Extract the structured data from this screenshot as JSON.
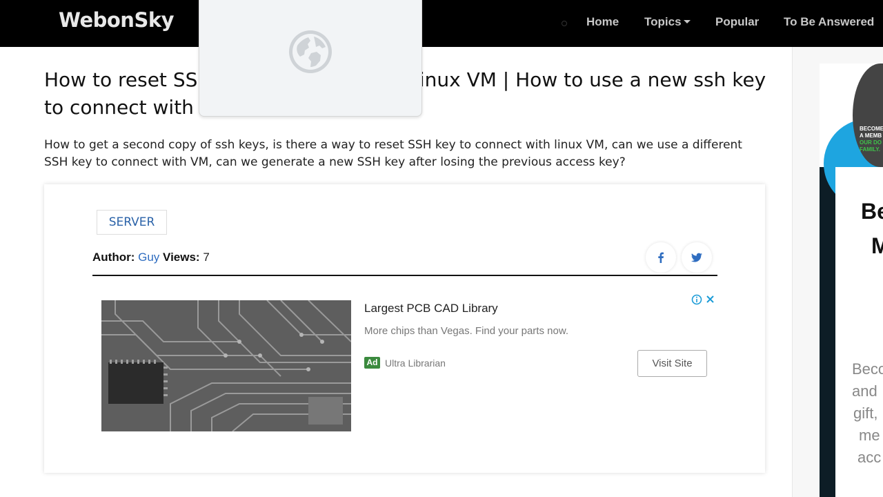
{
  "header": {
    "brand": "WebonSky",
    "nav": [
      {
        "label": "Home"
      },
      {
        "label": "Topics"
      },
      {
        "label": "Popular"
      },
      {
        "label": "To Be Answered"
      }
    ]
  },
  "article": {
    "title": "How to reset SSH key to connect with linux VM | How to use a new ssh key to connect with VM",
    "intro": "How to get a second copy of ssh keys, is there a way to reset SSH key to connect with linux VM, can we use a different SSH key to connect with VM, can we generate a new SSH key after losing the previous access key?",
    "tag": "SERVER",
    "author_label": "Author:",
    "author": "Guy",
    "views_label": "Views:",
    "views": "7"
  },
  "ad": {
    "title": "Largest PCB CAD Library",
    "description": "More chips than Vegas. Find your parts now.",
    "badge": "Ad",
    "source": "Ultra Librarian",
    "cta": "Visit Site"
  },
  "sidebar_ad": {
    "small_lines": [
      "BECOME",
      "A MEMB",
      "OUR DO",
      "FAMILY."
    ],
    "heading_lines": [
      "Be",
      "M"
    ],
    "text_lines": [
      "Beco",
      "and",
      "gift,",
      "me",
      "acc"
    ]
  },
  "colors": {
    "navbar": "#000000",
    "link": "#2f6dc0",
    "ad_badge": "#3b8a3e",
    "side_accent": "#1ea5e0"
  },
  "icons": {
    "popup": "globe-icon",
    "share_1": "facebook-icon",
    "share_2": "twitter-icon",
    "ad_info": "info-icon",
    "ad_close": "close-icon"
  }
}
